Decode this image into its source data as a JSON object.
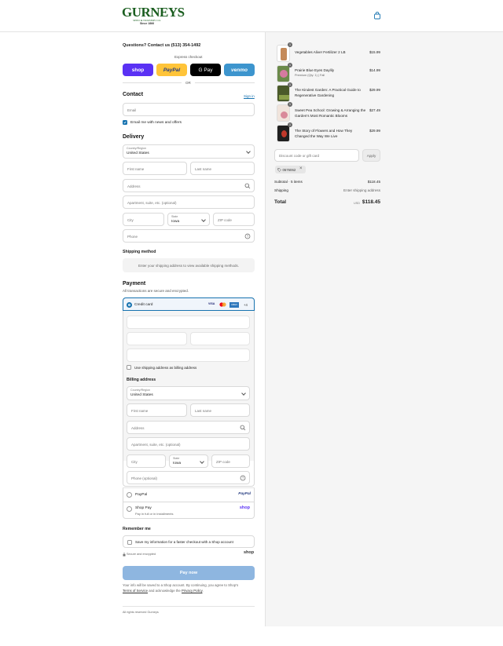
{
  "header": {
    "brand": "GURNEYS",
    "brand_sub": "SEED & NURSERY CO.",
    "since": "Since 1866"
  },
  "contact_line": "Questions? Contact us (513) 354-1492",
  "express": {
    "label": "Express checkout",
    "or": "OR",
    "buttons": {
      "shop": "shop",
      "paypal": "PayPal",
      "gpay": "G Pay",
      "venmo": "venmo"
    }
  },
  "contact": {
    "title": "Contact",
    "sign_in": "Sign in",
    "email_placeholder": "Email",
    "news_label": "Email me with news and offers",
    "news_checked": true
  },
  "delivery": {
    "title": "Delivery",
    "country_label": "Country/Region",
    "country": "United States",
    "first_name": "First name",
    "last_name": "Last name",
    "address": "Address",
    "apartment": "Apartment, suite, etc. (optional)",
    "city": "City",
    "state_label": "State",
    "state": "Iowa",
    "zip": "ZIP code",
    "phone": "Phone"
  },
  "shipping_method": {
    "title": "Shipping method",
    "message": "Enter your shipping address to view available shipping methods."
  },
  "payment": {
    "title": "Payment",
    "subtitle": "All transactions are secure and encrypted.",
    "credit_card": "Credit card",
    "cards": [
      "VISA",
      "MC",
      "AMEX"
    ],
    "more_cards": "+4",
    "use_shipping": "Use shipping address as billing address",
    "paypal": "PayPal",
    "paypal_logo": "PayPal",
    "shop_pay": "Shop Pay",
    "shop_pay_sub": "Pay in full or in installments",
    "shop_logo": "shop"
  },
  "billing": {
    "title": "Billing address",
    "country_label": "Country/Region",
    "country": "United States",
    "first_name": "First name",
    "last_name": "Last name",
    "address": "Address",
    "apartment": "Apartment, suite, etc. (optional)",
    "city": "City",
    "state_label": "State",
    "state": "Iowa",
    "zip": "ZIP code",
    "phone": "Phone (optional)"
  },
  "remember": {
    "title": "Remember me",
    "label": "Save my information for a faster checkout with a Shop account",
    "secure": "Secure and encrypted",
    "shop": "shop"
  },
  "pay_now": "Pay now",
  "legal": {
    "line1": "Your info will be saved to a Shop account. By continuing, you agree to Shop's",
    "terms": "Terms of Service",
    "and": "and acknowledge the",
    "privacy": "Privacy Policy",
    "end": "."
  },
  "footer": "All rights reserved Gurneys",
  "cart": {
    "items": [
      {
        "name": "Vegetables Alive! Fertilizer 2 LB",
        "variant": "",
        "price": "$15.99",
        "qty": "1",
        "thumb_color": "#c48a5a"
      },
      {
        "name": "Prairie Blue Eyes Daylily",
        "variant": "Premium (Qty: 1) | Fall",
        "price": "$14.99",
        "qty": "1",
        "thumb_color": "#b86b8a"
      },
      {
        "name": "The Kindest Garden: A Practical Guide to Regenerative Gardening",
        "variant": "",
        "price": "$29.99",
        "qty": "1",
        "thumb_color": "#4a5a2a"
      },
      {
        "name": "Sweet Pea School: Growing & Arranging the Garden's Most Romantic Blooms",
        "variant": "",
        "price": "$27.49",
        "qty": "1",
        "thumb_color": "#e8c8c8"
      },
      {
        "name": "The Story of Flowers and How They Changed the Way We Live",
        "variant": "",
        "price": "$29.99",
        "qty": "1",
        "thumb_color": "#1f1f1f"
      }
    ],
    "discount_placeholder": "Discount code or gift card",
    "apply": "Apply",
    "code": "0576062",
    "subtotal_label": "Subtotal · 5 items",
    "subtotal": "$118.45",
    "shipping_label": "Shipping",
    "shipping_value": "Enter shipping address",
    "total_label": "Total",
    "currency": "USD",
    "total": "$118.45"
  },
  "colors": {
    "accent": "#1773b0",
    "shop": "#5a31f4",
    "paypal": "#ffc439",
    "venmo": "#3d95ce",
    "pay_now": "#8eb6e0"
  }
}
